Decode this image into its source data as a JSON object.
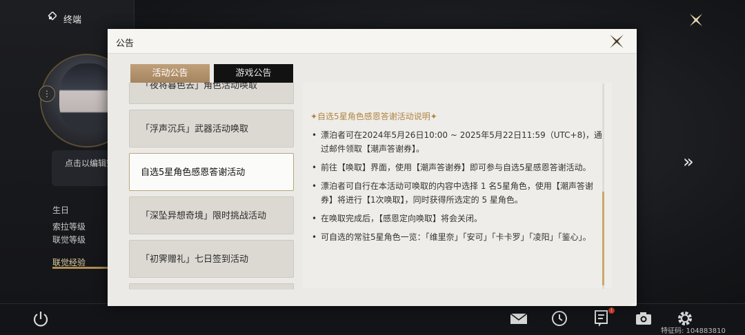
{
  "background": {
    "terminal_title": "终端",
    "edit_hint": "点击以编辑签",
    "stats": [
      "生日",
      "索拉等级",
      "联觉等级"
    ],
    "exp_label": "联觉经验",
    "uid_text": "特征码: 104883810",
    "notification_badge": "!"
  },
  "modal": {
    "title": "公告",
    "tabs": [
      {
        "label": "活动公告",
        "active": true
      },
      {
        "label": "游戏公告",
        "active": false
      }
    ],
    "list_items": [
      {
        "label": "「夜将暮色去」角色活动唤取"
      },
      {
        "label": "「浮声沉兵」武器活动唤取"
      },
      {
        "label": "自选5星角色感恩答谢活动",
        "selected": true
      },
      {
        "label": "「深坠异想奇境」限时挑战活动"
      },
      {
        "label": "「初霁赠礼」七日签到活动"
      }
    ],
    "content": {
      "section_title": "✦自选5星角色感恩答谢活动说明✦",
      "bullets": [
        "漂泊者可在2024年5月26日10:00 ~ 2025年5月22日11:59（UTC+8)，通过邮件领取【潮声答谢券】。",
        "前往【唤取】界面，使用【潮声答谢券】即可参与自选5星感恩答谢活动。",
        "漂泊者可自行在本活动可唤取的内容中选择 1 名5星角色，使用【潮声答谢券】将进行【1次唤取】，同时获得所选定的 5 星角色。",
        "在唤取完成后，【感恩定向唤取】将会关闭。",
        "可自选的常驻5星角色一览：「维里奈」「安可」「卡卡罗」「凌阳」「鉴心」。"
      ]
    }
  },
  "colors": {
    "accent_gold": "#b18542",
    "tab_active": "#a58560",
    "tab_inactive": "#121212"
  }
}
